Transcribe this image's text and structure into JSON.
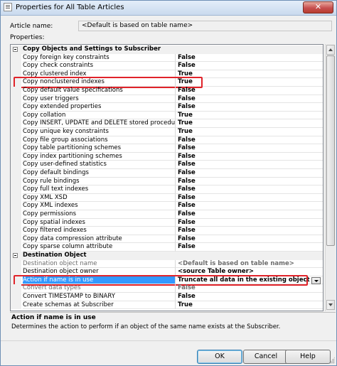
{
  "window": {
    "title": "Properties for All Table Articles",
    "close_label": "✕"
  },
  "article": {
    "label": "Article name:",
    "value": "<Default is based on table name>"
  },
  "properties_label": "Properties:",
  "grid": {
    "categories": [
      {
        "title": "Copy Objects and Settings to Subscriber",
        "rows": [
          {
            "name": "Copy foreign key constraints",
            "value": "False"
          },
          {
            "name": "Copy check constraints",
            "value": "False"
          },
          {
            "name": "Copy clustered index",
            "value": "True"
          },
          {
            "name": "Copy nonclustered indexes",
            "value": "True"
          },
          {
            "name": "Copy default value specifications",
            "value": "False"
          },
          {
            "name": "Copy user triggers",
            "value": "False"
          },
          {
            "name": "Copy extended properties",
            "value": "False"
          },
          {
            "name": "Copy collation",
            "value": "True"
          },
          {
            "name": "Copy INSERT, UPDATE and DELETE stored procedures",
            "value": "True"
          },
          {
            "name": "Copy unique key constraints",
            "value": "True"
          },
          {
            "name": "Copy file group associations",
            "value": "False"
          },
          {
            "name": "Copy table partitioning schemes",
            "value": "False"
          },
          {
            "name": "Copy index partitioning schemes",
            "value": "False"
          },
          {
            "name": "Copy user-defined statistics",
            "value": "False"
          },
          {
            "name": "Copy default bindings",
            "value": "False"
          },
          {
            "name": "Copy rule bindings",
            "value": "False"
          },
          {
            "name": "Copy full text indexes",
            "value": "False"
          },
          {
            "name": "Copy XML XSD",
            "value": "False"
          },
          {
            "name": "Copy XML indexes",
            "value": "False"
          },
          {
            "name": "Copy permissions",
            "value": "False"
          },
          {
            "name": "Copy spatial indexes",
            "value": "False"
          },
          {
            "name": "Copy filtered indexes",
            "value": "False"
          },
          {
            "name": "Copy data compression attribute",
            "value": "False"
          },
          {
            "name": "Copy sparse column attribute",
            "value": "False"
          }
        ]
      },
      {
        "title": "Destination Object",
        "rows": [
          {
            "name": "Destination object name",
            "value": "<Default is based on table name>"
          },
          {
            "name": "Destination object owner",
            "value": "<source Table owner>"
          },
          {
            "name": "Action if name is in use",
            "value": "Truncate all data in the existing object"
          },
          {
            "name": "Convert data types",
            "value": "False"
          },
          {
            "name": "Convert TIMESTAMP to BINARY",
            "value": "False"
          },
          {
            "name": "Create schemas at Subscriber",
            "value": "True"
          }
        ]
      }
    ]
  },
  "description": {
    "title": "Action if name is in use",
    "text": "Determines the action to perform if an object of the same name exists at the Subscriber."
  },
  "buttons": {
    "ok": "OK",
    "cancel": "Cancel",
    "help": "Help"
  },
  "colors": {
    "highlight": "#e0232a",
    "selection": "#3399ff"
  }
}
